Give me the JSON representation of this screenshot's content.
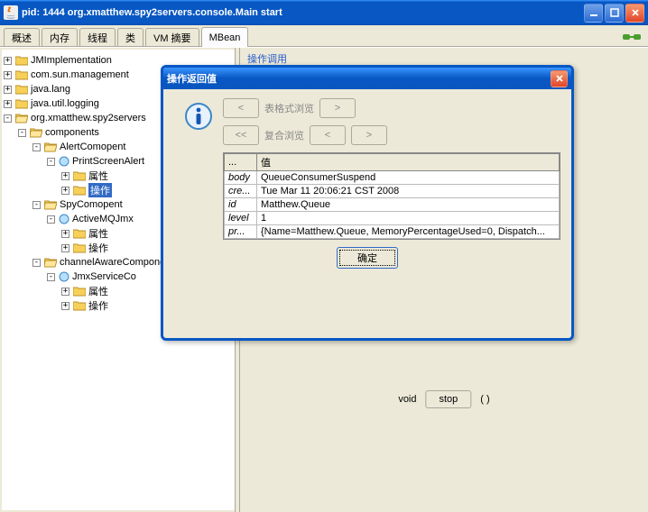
{
  "window": {
    "title": "pid: 1444 org.xmatthew.spy2servers.console.Main start"
  },
  "tabs": [
    {
      "label": "概述"
    },
    {
      "label": "内存"
    },
    {
      "label": "线程"
    },
    {
      "label": "类"
    },
    {
      "label": "VM 摘要"
    },
    {
      "label": "MBean"
    }
  ],
  "detail": {
    "op_call_label": "操作调用",
    "void_label": "void",
    "stop_label": "stop",
    "parens": "( )"
  },
  "tree": {
    "root": [
      {
        "label": "JMImplementation"
      },
      {
        "label": "com.sun.management"
      },
      {
        "label": "java.lang"
      },
      {
        "label": "java.util.logging"
      },
      {
        "label": "org.xmatthew.spy2servers"
      }
    ],
    "components_label": "components",
    "alert_label": "AlertComopent",
    "print_label": "PrintScreenAlert",
    "attr_label": "属性",
    "op_label": "操作",
    "spy_label": "SpyComopent",
    "activemq_label": "ActiveMQJmx",
    "channel_label": "channelAwareComponent",
    "jmx_label": "JmxServiceCo"
  },
  "dialog": {
    "title": "操作返回值",
    "nav1_label": "表格式浏览",
    "nav2_label": "复合浏览",
    "btn_prev": "<",
    "btn_next": ">",
    "btn_first": "<<",
    "col1": "...",
    "col2": "值",
    "rows": [
      {
        "k": "body",
        "v": "QueueConsumerSuspend"
      },
      {
        "k": "cre...",
        "v": "Tue Mar 11 20:06:21 CST 2008"
      },
      {
        "k": "id",
        "v": "Matthew.Queue"
      },
      {
        "k": "level",
        "v": "1"
      },
      {
        "k": "pr...",
        "v": "{Name=Matthew.Queue, MemoryPercentageUsed=0, Dispatch..."
      }
    ],
    "ok_label": "确定"
  }
}
